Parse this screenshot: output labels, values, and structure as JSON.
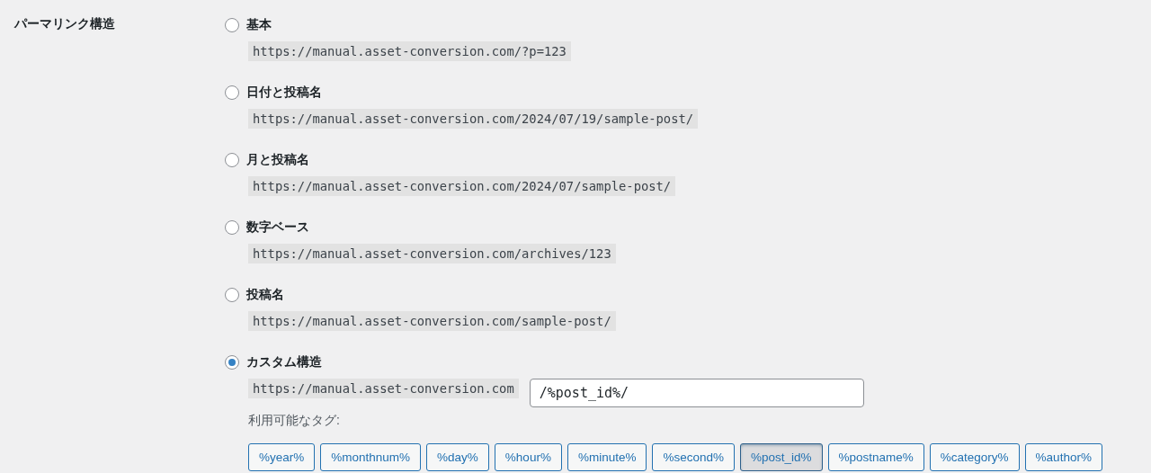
{
  "section_label": "パーマリンク構造",
  "options": [
    {
      "label": "基本",
      "selected": false,
      "example": "https://manual.asset-conversion.com/?p=123"
    },
    {
      "label": "日付と投稿名",
      "selected": false,
      "example": "https://manual.asset-conversion.com/2024/07/19/sample-post/"
    },
    {
      "label": "月と投稿名",
      "selected": false,
      "example": "https://manual.asset-conversion.com/2024/07/sample-post/"
    },
    {
      "label": "数字ベース",
      "selected": false,
      "example": "https://manual.asset-conversion.com/archives/123"
    },
    {
      "label": "投稿名",
      "selected": false,
      "example": "https://manual.asset-conversion.com/sample-post/"
    },
    {
      "label": "カスタム構造",
      "selected": true,
      "kind": "custom",
      "prefix": "https://manual.asset-conversion.com",
      "value": "/%post_id%/"
    }
  ],
  "tags_label": "利用可能なタグ:",
  "tags": [
    {
      "label": "%year%",
      "selected": false
    },
    {
      "label": "%monthnum%",
      "selected": false
    },
    {
      "label": "%day%",
      "selected": false
    },
    {
      "label": "%hour%",
      "selected": false
    },
    {
      "label": "%minute%",
      "selected": false
    },
    {
      "label": "%second%",
      "selected": false
    },
    {
      "label": "%post_id%",
      "selected": true
    },
    {
      "label": "%postname%",
      "selected": false
    },
    {
      "label": "%category%",
      "selected": false
    },
    {
      "label": "%author%",
      "selected": false
    }
  ]
}
